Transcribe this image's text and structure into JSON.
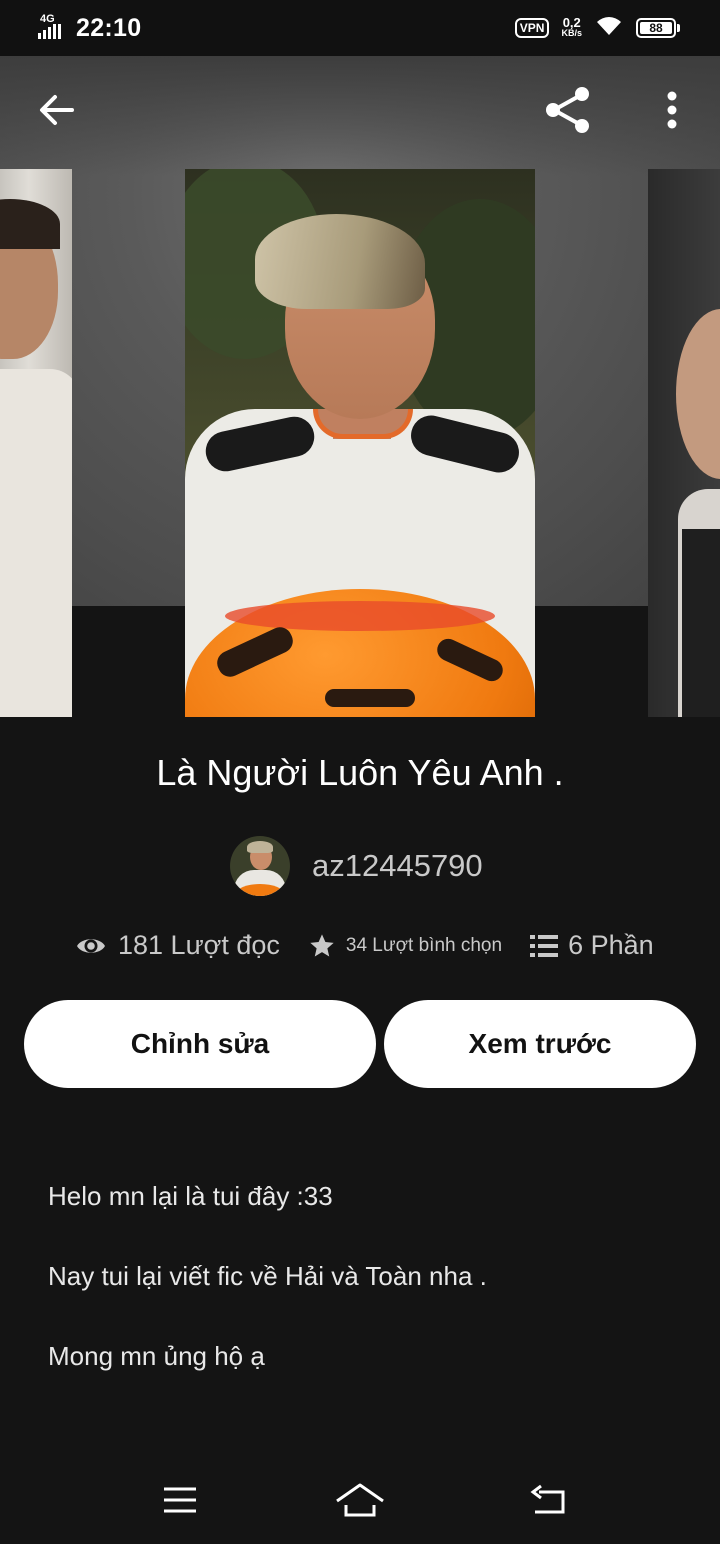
{
  "status_bar": {
    "network": "4G",
    "time": "22:10",
    "vpn": "VPN",
    "speed_value": "0,2",
    "speed_unit": "KB/s",
    "battery": "88"
  },
  "toolbar": {
    "back_icon": "arrow-left-icon",
    "share_icon": "share-icon",
    "more_icon": "more-vertical-icon"
  },
  "story": {
    "title": "Là Người Luôn Yêu Anh .",
    "author": "az12445790",
    "reads": "181 Lượt đọc",
    "votes": "34 Lượt bình chọn",
    "parts": "6 Phần"
  },
  "actions": {
    "edit_label": "Chỉnh sửa",
    "preview_label": "Xem trước"
  },
  "description": [
    "Helo mn lại là tui đây :33",
    "Nay tui lại viết fic về Hải và Toàn nha .",
    "Mong mn ủng hộ ạ"
  ],
  "navbar": {
    "menu_icon": "menu-icon",
    "home_icon": "home-icon",
    "back_icon": "return-icon"
  },
  "colors": {
    "background": "#141414",
    "button": "#ffffff",
    "muted_text": "#c9c9c9"
  }
}
